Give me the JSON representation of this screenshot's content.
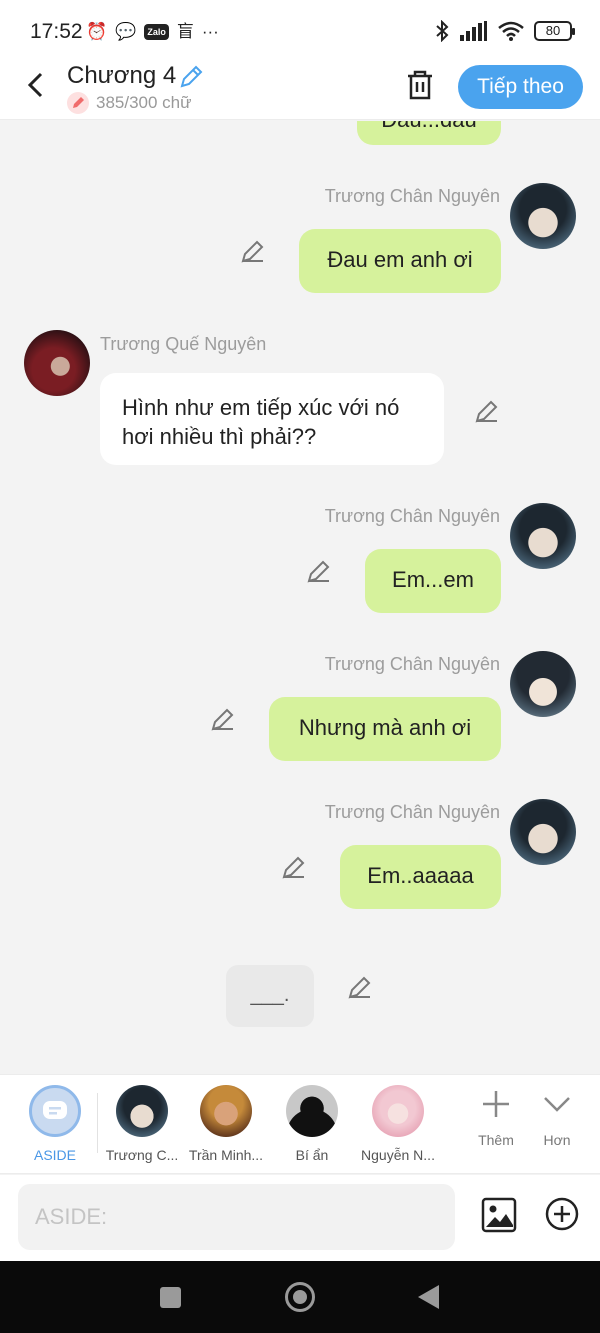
{
  "status": {
    "time": "17:52",
    "zalo": "Zalo",
    "misc_glyph": "盲",
    "dots": "···",
    "battery": "80"
  },
  "header": {
    "title": "Chương 4",
    "word_count": "385/300 chữ",
    "next_label": "Tiếp theo"
  },
  "messages": [
    {
      "side": "right",
      "text": "Đau...đau"
    },
    {
      "side": "right",
      "name": "Trương Chân Nguyên",
      "text": "Đau em anh ơi"
    },
    {
      "side": "left",
      "name": "Trương Quế Nguyên",
      "text": "Hình như em tiếp xúc với nó hơi nhiều thì phải??"
    },
    {
      "side": "right",
      "name": "Trương Chân Nguyên",
      "text": "Em...em"
    },
    {
      "side": "right",
      "name": "Trương Chân Nguyên",
      "text": "Nhưng mà anh ơi"
    },
    {
      "side": "right",
      "name": "Trương Chân Nguyên",
      "text": "Em..aaaaa"
    }
  ],
  "aside_message": "___.",
  "characters": [
    {
      "label": "ASIDE"
    },
    {
      "label": "Trương C..."
    },
    {
      "label": "Trần Minh..."
    },
    {
      "label": "Bí ẩn"
    },
    {
      "label": "Nguyễn N..."
    }
  ],
  "actions": {
    "add_label": "Thêm",
    "more_label": "Hơn"
  },
  "input": {
    "placeholder": "ASIDE:"
  }
}
